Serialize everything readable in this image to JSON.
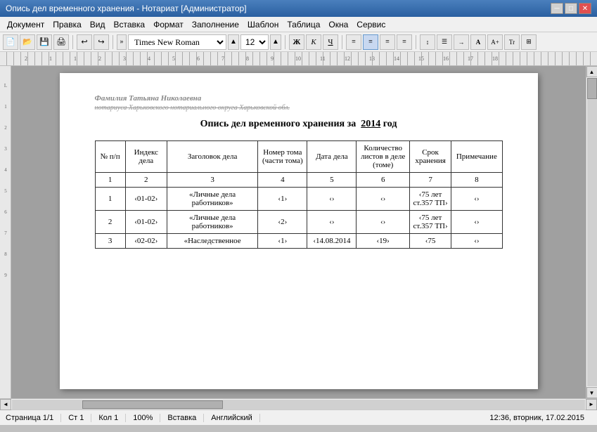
{
  "titleBar": {
    "title": "Опись дел временного хранения - Нотариат [Администратор]",
    "minimizeLabel": "─",
    "maximizeLabel": "□",
    "closeLabel": "✕"
  },
  "menuBar": {
    "items": [
      "Документ",
      "Правка",
      "Вид",
      "Вставка",
      "Формат",
      "Заполнение",
      "Шаблон",
      "Таблица",
      "Окна",
      "Сервис"
    ]
  },
  "toolbar": {
    "fontName": "Times New Roman",
    "fontSize": "12",
    "boldLabel": "Ж",
    "italicLabel": "К",
    "underlineLabel": "Ч"
  },
  "document": {
    "headerLine1": "Фамилия Татьяна Николаевна",
    "headerLine2": "нотариуса Харьковского нотариального округа Харьковской обл.",
    "title": "Опись дел временного хранения за",
    "year": "2014",
    "yearSuffix": " год",
    "tableHeaders": {
      "col1": "№ п/п",
      "col2": "Индекс дела",
      "col3": "Заголовок дела",
      "col4": "Номер тома (части тома)",
      "col5": "Дата дела",
      "col6": "Количество листов в деле (томе)",
      "col7": "Срок хранения",
      "col8": "Примечание"
    },
    "tableNumRow": {
      "c1": "1",
      "c2": "2",
      "c3": "3",
      "c4": "4",
      "c5": "5",
      "c6": "6",
      "c7": "7",
      "c8": "8"
    },
    "rows": [
      {
        "num": "1",
        "index": "‹01-02›",
        "title": "«Личные дела работников»",
        "volume": "‹1›",
        "date": "‹›",
        "sheets": "‹›",
        "storage": "‹75 лет ст.357 ТП›",
        "note": "‹›"
      },
      {
        "num": "2",
        "index": "‹01-02›",
        "title": "«Личные дела работников»",
        "volume": "‹2›",
        "date": "‹›",
        "sheets": "‹›",
        "storage": "‹75 лет ст.357 ТП›",
        "note": "‹›"
      },
      {
        "num": "3",
        "index": "‹02-02›",
        "title": "«Наследственное",
        "volume": "‹1›",
        "date": "‹14.08.2014",
        "sheets": "‹19›",
        "storage": "‹75",
        "note": "‹›"
      }
    ]
  },
  "statusBar": {
    "page": "Страница 1/1",
    "row": "Ст 1",
    "col": "Кол 1",
    "zoom": "100%",
    "mode": "Вставка",
    "lang": "Английский",
    "datetime": "12:36, вторник, 17.02.2015"
  }
}
